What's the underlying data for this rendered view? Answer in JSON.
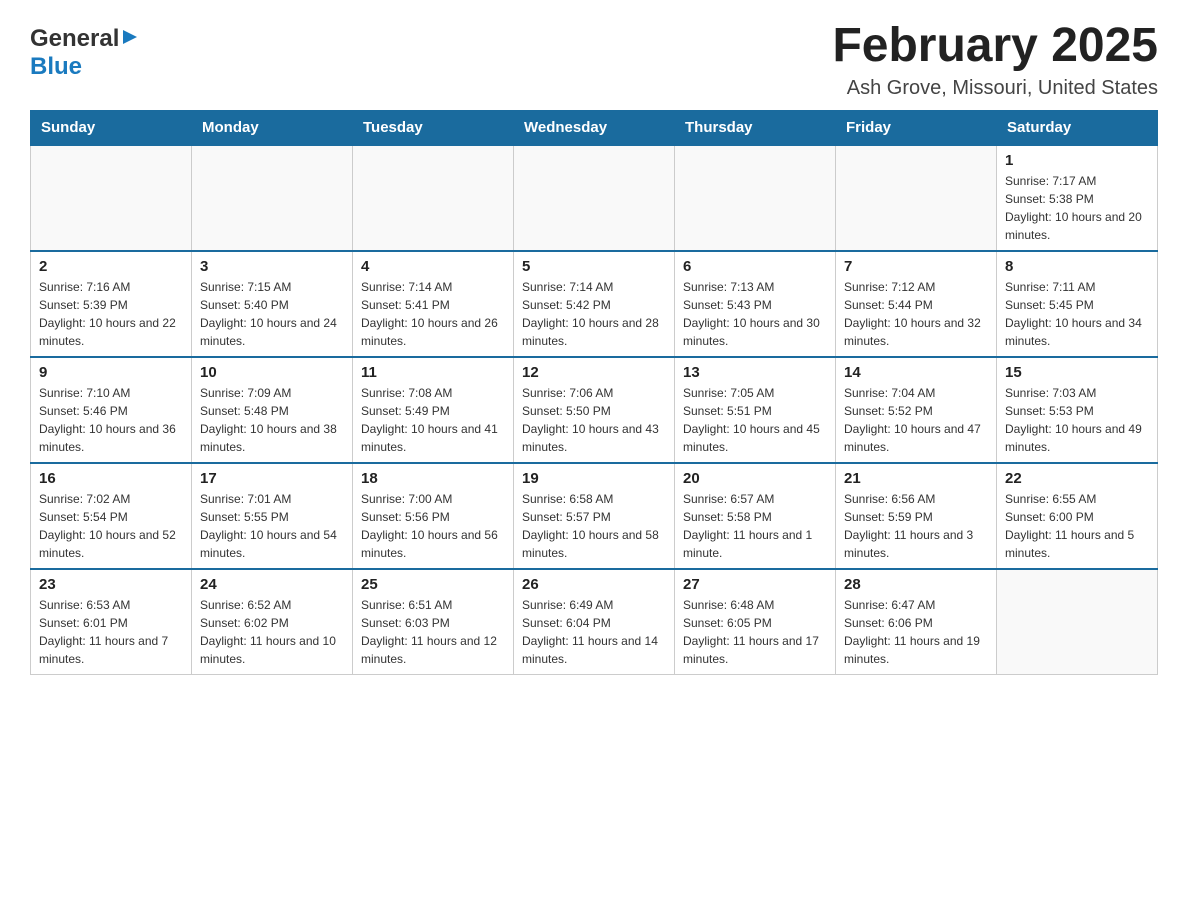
{
  "header": {
    "logo_general": "General",
    "logo_blue": "Blue",
    "title": "February 2025",
    "subtitle": "Ash Grove, Missouri, United States"
  },
  "calendar": {
    "days_of_week": [
      "Sunday",
      "Monday",
      "Tuesday",
      "Wednesday",
      "Thursday",
      "Friday",
      "Saturday"
    ],
    "weeks": [
      [
        {
          "day": "",
          "info": ""
        },
        {
          "day": "",
          "info": ""
        },
        {
          "day": "",
          "info": ""
        },
        {
          "day": "",
          "info": ""
        },
        {
          "day": "",
          "info": ""
        },
        {
          "day": "",
          "info": ""
        },
        {
          "day": "1",
          "info": "Sunrise: 7:17 AM\nSunset: 5:38 PM\nDaylight: 10 hours and 20 minutes."
        }
      ],
      [
        {
          "day": "2",
          "info": "Sunrise: 7:16 AM\nSunset: 5:39 PM\nDaylight: 10 hours and 22 minutes."
        },
        {
          "day": "3",
          "info": "Sunrise: 7:15 AM\nSunset: 5:40 PM\nDaylight: 10 hours and 24 minutes."
        },
        {
          "day": "4",
          "info": "Sunrise: 7:14 AM\nSunset: 5:41 PM\nDaylight: 10 hours and 26 minutes."
        },
        {
          "day": "5",
          "info": "Sunrise: 7:14 AM\nSunset: 5:42 PM\nDaylight: 10 hours and 28 minutes."
        },
        {
          "day": "6",
          "info": "Sunrise: 7:13 AM\nSunset: 5:43 PM\nDaylight: 10 hours and 30 minutes."
        },
        {
          "day": "7",
          "info": "Sunrise: 7:12 AM\nSunset: 5:44 PM\nDaylight: 10 hours and 32 minutes."
        },
        {
          "day": "8",
          "info": "Sunrise: 7:11 AM\nSunset: 5:45 PM\nDaylight: 10 hours and 34 minutes."
        }
      ],
      [
        {
          "day": "9",
          "info": "Sunrise: 7:10 AM\nSunset: 5:46 PM\nDaylight: 10 hours and 36 minutes."
        },
        {
          "day": "10",
          "info": "Sunrise: 7:09 AM\nSunset: 5:48 PM\nDaylight: 10 hours and 38 minutes."
        },
        {
          "day": "11",
          "info": "Sunrise: 7:08 AM\nSunset: 5:49 PM\nDaylight: 10 hours and 41 minutes."
        },
        {
          "day": "12",
          "info": "Sunrise: 7:06 AM\nSunset: 5:50 PM\nDaylight: 10 hours and 43 minutes."
        },
        {
          "day": "13",
          "info": "Sunrise: 7:05 AM\nSunset: 5:51 PM\nDaylight: 10 hours and 45 minutes."
        },
        {
          "day": "14",
          "info": "Sunrise: 7:04 AM\nSunset: 5:52 PM\nDaylight: 10 hours and 47 minutes."
        },
        {
          "day": "15",
          "info": "Sunrise: 7:03 AM\nSunset: 5:53 PM\nDaylight: 10 hours and 49 minutes."
        }
      ],
      [
        {
          "day": "16",
          "info": "Sunrise: 7:02 AM\nSunset: 5:54 PM\nDaylight: 10 hours and 52 minutes."
        },
        {
          "day": "17",
          "info": "Sunrise: 7:01 AM\nSunset: 5:55 PM\nDaylight: 10 hours and 54 minutes."
        },
        {
          "day": "18",
          "info": "Sunrise: 7:00 AM\nSunset: 5:56 PM\nDaylight: 10 hours and 56 minutes."
        },
        {
          "day": "19",
          "info": "Sunrise: 6:58 AM\nSunset: 5:57 PM\nDaylight: 10 hours and 58 minutes."
        },
        {
          "day": "20",
          "info": "Sunrise: 6:57 AM\nSunset: 5:58 PM\nDaylight: 11 hours and 1 minute."
        },
        {
          "day": "21",
          "info": "Sunrise: 6:56 AM\nSunset: 5:59 PM\nDaylight: 11 hours and 3 minutes."
        },
        {
          "day": "22",
          "info": "Sunrise: 6:55 AM\nSunset: 6:00 PM\nDaylight: 11 hours and 5 minutes."
        }
      ],
      [
        {
          "day": "23",
          "info": "Sunrise: 6:53 AM\nSunset: 6:01 PM\nDaylight: 11 hours and 7 minutes."
        },
        {
          "day": "24",
          "info": "Sunrise: 6:52 AM\nSunset: 6:02 PM\nDaylight: 11 hours and 10 minutes."
        },
        {
          "day": "25",
          "info": "Sunrise: 6:51 AM\nSunset: 6:03 PM\nDaylight: 11 hours and 12 minutes."
        },
        {
          "day": "26",
          "info": "Sunrise: 6:49 AM\nSunset: 6:04 PM\nDaylight: 11 hours and 14 minutes."
        },
        {
          "day": "27",
          "info": "Sunrise: 6:48 AM\nSunset: 6:05 PM\nDaylight: 11 hours and 17 minutes."
        },
        {
          "day": "28",
          "info": "Sunrise: 6:47 AM\nSunset: 6:06 PM\nDaylight: 11 hours and 19 minutes."
        },
        {
          "day": "",
          "info": ""
        }
      ]
    ]
  }
}
